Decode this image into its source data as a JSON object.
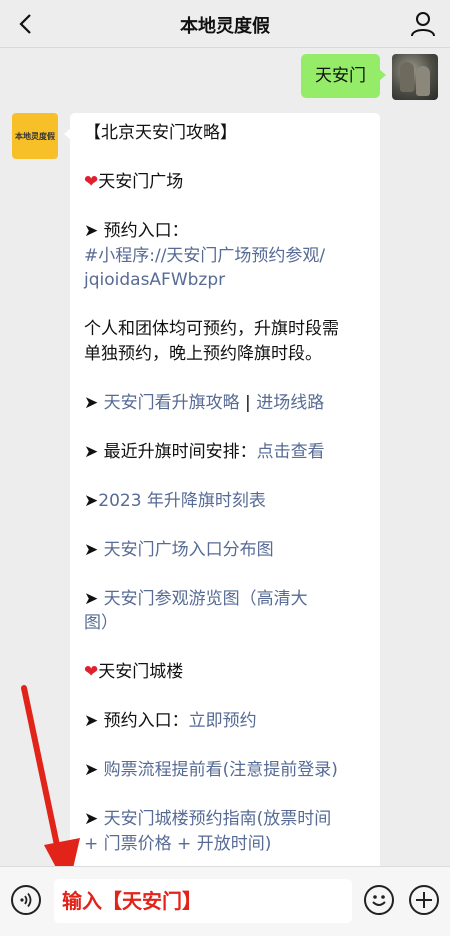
{
  "header": {
    "title": "本地灵度假",
    "back_icon": "chevron-left-icon",
    "profile_icon": "person-icon"
  },
  "my_message": {
    "text": "天安门"
  },
  "bot": {
    "avatar_label": "本地灵度假"
  },
  "bot_message": {
    "title": "【北京天安门攻略】",
    "section1_heading": "天安门广场",
    "s1_reserve_label": "➤ 预约入口：",
    "s1_reserve_link_line1": "#小程序://天安门广场预约参观/",
    "s1_reserve_link_line2": "jqioidasAFWbzpr",
    "s1_desc_line1": "个人和团体均可预约，升旗时段需",
    "s1_desc_line2": "单独预约，晚上预约降旗时段。",
    "s1_arrow1": "➤ ",
    "s1_link_flag_strategy": "天安门看升旗攻略",
    "s1_sep": " | ",
    "s1_link_route": "进场线路",
    "s1_arrow2": "➤ 最近升旗时间安排：",
    "s1_link_view": "点击查看",
    "s1_arrow3": "➤",
    "s1_link_timetable": "2023 年升降旗时刻表",
    "s1_arrow4": "➤ ",
    "s1_link_entrance_map": "天安门广场入口分布图",
    "s1_arrow5": "➤ ",
    "s1_link_tour_map_line1": "天安门参观游览图（高清大",
    "s1_link_tour_map_line2": "图）",
    "section2_heading": "天安门城楼",
    "s2_reserve_label": "➤ 预约入口：",
    "s2_link_reserve_now": "立即预约",
    "s2_arrow1": "➤ ",
    "s2_link_ticket_flow": "购票流程提前看(注意提前登录)",
    "s2_arrow2": "➤ ",
    "s2_link_guide_line1": "天安门城楼预约指南(放票时间",
    "s2_link_guide_line2": "+ 门票价格 + 开放时间)"
  },
  "heart_icon": "heart-icon",
  "input_bar": {
    "voice_icon": "voice-icon",
    "input_text": "输入【天安门】",
    "emoji_icon": "emoji-icon",
    "plus_icon": "plus-icon"
  },
  "colors": {
    "link": "#576b95",
    "my_bubble": "#95ec69",
    "annotation_red": "#e2231a"
  }
}
